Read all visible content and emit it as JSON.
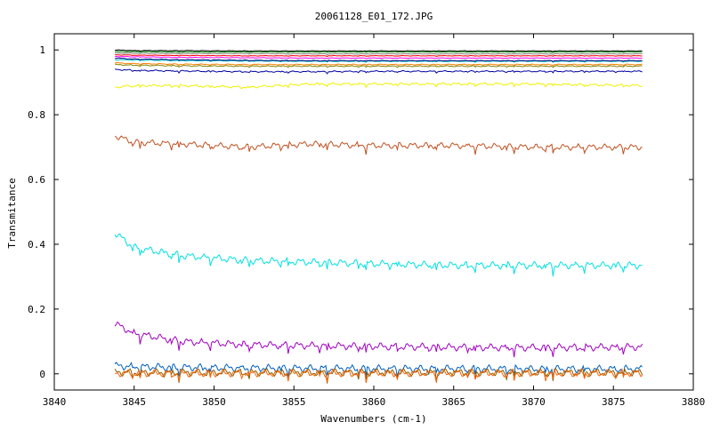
{
  "chart_data": {
    "type": "line",
    "title": "20061128_E01_172.JPG",
    "xlabel": "Wavenumbers (cm-1)",
    "ylabel": "Transmitance",
    "xlim": [
      3840,
      3880
    ],
    "ylim": [
      -0.05,
      1.05
    ],
    "x_ticks": [
      3840,
      3845,
      3850,
      3855,
      3860,
      3865,
      3870,
      3875,
      3880
    ],
    "y_ticks": [
      0,
      0.2,
      0.4,
      0.6,
      0.8,
      1
    ],
    "x_tick_labels": [
      "3840",
      "3845",
      "3850",
      "3855",
      "3860",
      "3865",
      "3870",
      "3875",
      "3880"
    ],
    "y_tick_labels": [
      "0",
      "0.2",
      "0.4",
      "0.6",
      "0.8",
      "1"
    ],
    "grid": false,
    "x_range_of_data": [
      3843.8,
      3876.8
    ],
    "series": [
      {
        "color": "#000000",
        "x": [
          3843.8,
          3845,
          3848,
          3852,
          3856,
          3860,
          3865,
          3870,
          3876.8
        ],
        "y": [
          1.0,
          0.998,
          0.998,
          0.997,
          0.997,
          0.997,
          0.997,
          0.997,
          0.997
        ]
      },
      {
        "color": "#008000",
        "x": [
          3843.8,
          3845,
          3848,
          3852,
          3856,
          3860,
          3865,
          3870,
          3876.8
        ],
        "y": [
          0.995,
          0.995,
          0.994,
          0.994,
          0.994,
          0.994,
          0.994,
          0.994,
          0.994
        ]
      },
      {
        "color": "#808080",
        "x": [
          3843.8,
          3845,
          3848,
          3852,
          3856,
          3860,
          3865,
          3870,
          3876.8
        ],
        "y": [
          0.99,
          0.99,
          0.989,
          0.989,
          0.988,
          0.988,
          0.988,
          0.988,
          0.988
        ]
      },
      {
        "color": "#ff0000",
        "x": [
          3843.8,
          3845,
          3848,
          3852,
          3856,
          3860,
          3865,
          3870,
          3876.8
        ],
        "y": [
          0.985,
          0.984,
          0.983,
          0.982,
          0.982,
          0.982,
          0.982,
          0.982,
          0.982
        ]
      },
      {
        "color": "#ff00ff",
        "x": [
          3843.8,
          3845,
          3848,
          3852,
          3856,
          3860,
          3865,
          3870,
          3876.8
        ],
        "y": [
          0.98,
          0.979,
          0.977,
          0.976,
          0.975,
          0.975,
          0.975,
          0.975,
          0.975
        ]
      },
      {
        "color": "#00c0c0",
        "x": [
          3843.8,
          3845,
          3848,
          3852,
          3856,
          3860,
          3865,
          3870,
          3876.8
        ],
        "y": [
          0.97,
          0.969,
          0.967,
          0.966,
          0.965,
          0.965,
          0.965,
          0.965,
          0.965
        ]
      },
      {
        "color": "#000080",
        "x": [
          3843.8,
          3845,
          3848,
          3852,
          3856,
          3860,
          3865,
          3870,
          3876.8
        ],
        "y": [
          0.975,
          0.972,
          0.97,
          0.968,
          0.967,
          0.967,
          0.967,
          0.967,
          0.967
        ]
      },
      {
        "color": "#ff8000",
        "x": [
          3843.8,
          3845,
          3848,
          3852,
          3856,
          3860,
          3865,
          3870,
          3876.8
        ],
        "y": [
          0.96,
          0.958,
          0.956,
          0.955,
          0.955,
          0.955,
          0.955,
          0.955,
          0.955
        ]
      },
      {
        "color": "#808000",
        "x": [
          3843.8,
          3845,
          3848,
          3852,
          3856,
          3860,
          3865,
          3870,
          3876.8
        ],
        "y": [
          0.955,
          0.953,
          0.951,
          0.95,
          0.95,
          0.95,
          0.95,
          0.95,
          0.95
        ]
      },
      {
        "color": "#0000a0",
        "x": [
          3843.8,
          3845,
          3848,
          3852,
          3856,
          3860,
          3865,
          3870,
          3876.8
        ],
        "y": [
          0.94,
          0.937,
          0.935,
          0.933,
          0.933,
          0.934,
          0.934,
          0.934,
          0.934
        ]
      },
      {
        "color": "#f0f000",
        "x": [
          3843.8,
          3845,
          3848,
          3852,
          3856,
          3860,
          3865,
          3870,
          3876.8
        ],
        "y": [
          0.885,
          0.89,
          0.89,
          0.885,
          0.895,
          0.895,
          0.895,
          0.895,
          0.89
        ]
      },
      {
        "color": "#c05020",
        "x": [
          3843.8,
          3845,
          3848,
          3852,
          3856,
          3860,
          3865,
          3870,
          3876.8
        ],
        "y": [
          0.735,
          0.715,
          0.71,
          0.7,
          0.71,
          0.705,
          0.705,
          0.7,
          0.7
        ]
      },
      {
        "color": "#00e0e0",
        "x": [
          3843.8,
          3845,
          3848,
          3852,
          3856,
          3860,
          3865,
          3870,
          3876.8
        ],
        "y": [
          0.435,
          0.39,
          0.365,
          0.35,
          0.345,
          0.34,
          0.335,
          0.335,
          0.335
        ]
      },
      {
        "color": "#a000c0",
        "x": [
          3843.8,
          3845,
          3848,
          3852,
          3856,
          3860,
          3865,
          3870,
          3876.8
        ],
        "y": [
          0.155,
          0.125,
          0.1,
          0.09,
          0.087,
          0.085,
          0.082,
          0.081,
          0.083
        ]
      },
      {
        "color": "#0060c0",
        "x": [
          3843.8,
          3845,
          3848,
          3852,
          3856,
          3860,
          3865,
          3870,
          3876.8
        ],
        "y": [
          0.025,
          0.022,
          0.02,
          0.018,
          0.017,
          0.016,
          0.016,
          0.015,
          0.015
        ]
      },
      {
        "color": "#806000",
        "x": [
          3843.8,
          3845,
          3848,
          3852,
          3856,
          3860,
          3865,
          3870,
          3876.8
        ],
        "y": [
          0.005,
          0.004,
          0.004,
          0.004,
          0.004,
          0.004,
          0.004,
          0.004,
          0.004
        ]
      },
      {
        "color": "#ff6000",
        "x": [
          3843.8,
          3845,
          3848,
          3852,
          3856,
          3860,
          3865,
          3870,
          3876.8
        ],
        "y": [
          0.002,
          0.002,
          0.002,
          0.002,
          0.002,
          0.002,
          0.002,
          0.002,
          0.002
        ]
      }
    ]
  }
}
